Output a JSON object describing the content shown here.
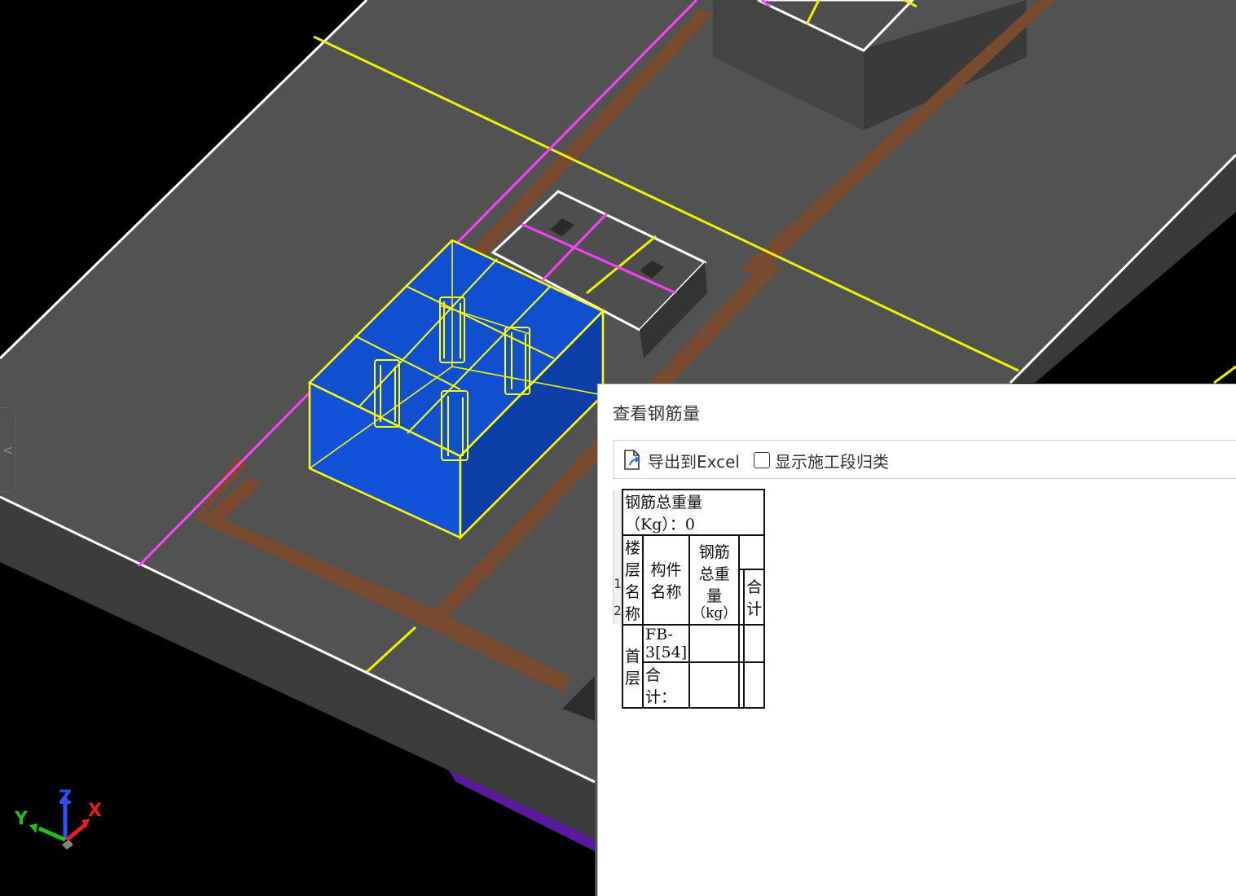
{
  "viewport": {
    "name": "3D structural model view",
    "colors": {
      "background": "#000000",
      "slab": "#525252",
      "slab_side": "#3c3c3c",
      "selected_component": "#1050d0",
      "selection_outline": "#ffff00",
      "axis_line_yellow": "#f0f000",
      "axis_line_magenta": "#ff40ff",
      "beam": "#7a4a2e",
      "edge": "#ffffff"
    },
    "axis_gizmo": {
      "x_label": "X",
      "y_label": "Y",
      "z_label": "Z",
      "x_color": "#e02020",
      "y_color": "#20c020",
      "z_color": "#3050ff"
    },
    "collapse_tab_glyph": "<"
  },
  "dialog": {
    "title": "查看钢筋量",
    "toolbar": {
      "export_label": "导出到Excel",
      "export_icon": "export-file-icon",
      "show_stage_label": "显示施工段归类",
      "show_stage_checked": false
    },
    "table": {
      "summary": "钢筋总重量（Kg）：0",
      "headers": {
        "floor_name": "楼层名称",
        "component_name": "构件名称",
        "total_weight": "钢筋总重量",
        "total_weight_unit": "（kg）",
        "subtotal": "合计"
      },
      "row_numbers": [
        "1",
        "2"
      ],
      "floor": "首层",
      "rows": [
        {
          "component": "FB-3[54]",
          "total_weight": "",
          "col4": "",
          "subtotal": ""
        },
        {
          "component": "合计：",
          "total_weight": "",
          "col4": "",
          "subtotal": ""
        }
      ]
    }
  }
}
